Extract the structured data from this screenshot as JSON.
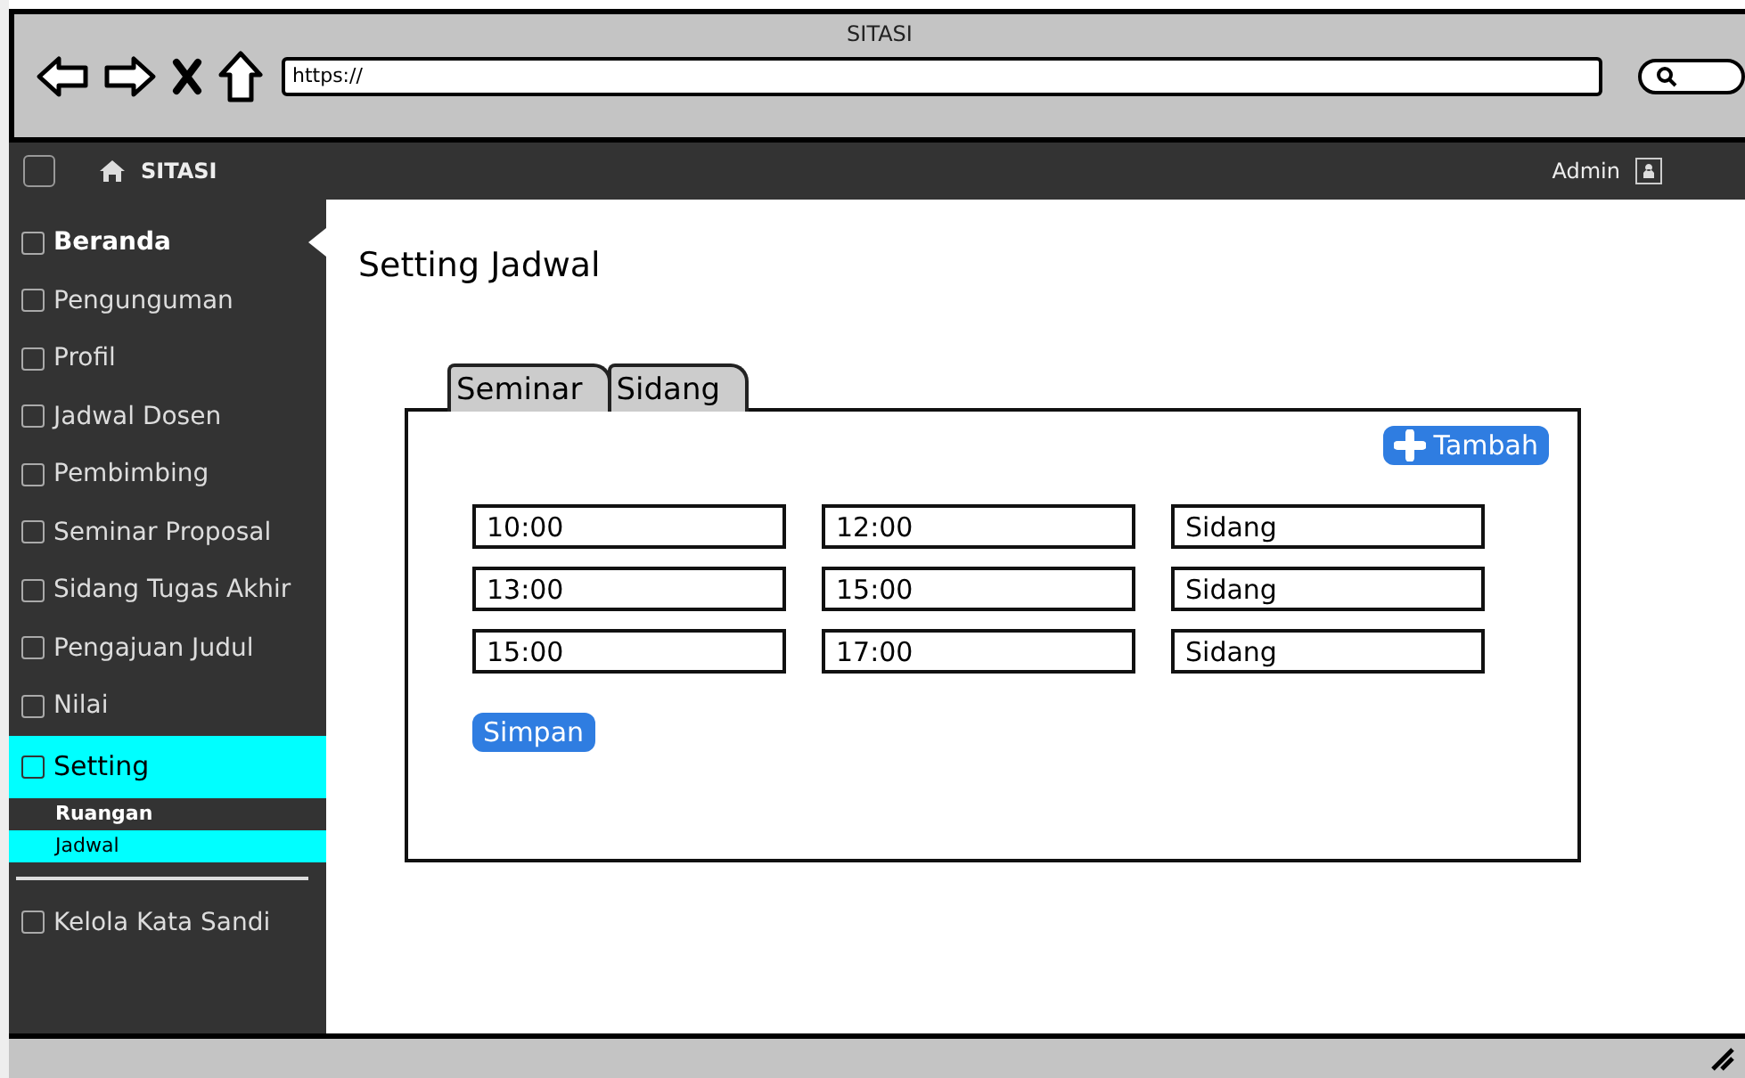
{
  "window": {
    "title": "SITASI"
  },
  "browser": {
    "url": "https://"
  },
  "navbar": {
    "brand": "SITASI",
    "user": "Admin"
  },
  "sidebar": {
    "items": [
      {
        "label": "Beranda",
        "selected": false,
        "bold": true
      },
      {
        "label": "Pengunguman",
        "selected": false,
        "bold": false
      },
      {
        "label": "Profil",
        "selected": false,
        "bold": false
      },
      {
        "label": "Jadwal Dosen",
        "selected": false,
        "bold": false
      },
      {
        "label": "Pembimbing",
        "selected": false,
        "bold": false
      },
      {
        "label": "Seminar Proposal",
        "selected": false,
        "bold": false
      },
      {
        "label": "Sidang Tugas Akhir",
        "selected": false,
        "bold": false
      },
      {
        "label": "Pengajuan Judul",
        "selected": false,
        "bold": false
      },
      {
        "label": "Nilai",
        "selected": false,
        "bold": false
      },
      {
        "label": "Setting",
        "selected": true,
        "bold": false,
        "children": [
          {
            "label": "Ruangan",
            "selected": false
          },
          {
            "label": "Jadwal",
            "selected": true
          }
        ]
      },
      {
        "label": "Kelola Kata Sandi",
        "selected": false,
        "bold": false
      }
    ]
  },
  "page": {
    "title": "Setting Jadwal",
    "tabs": [
      {
        "label": "Seminar"
      },
      {
        "label": "Sidang"
      }
    ],
    "add_button": "Tambah",
    "rows": [
      {
        "start": "10:00",
        "end": "12:00",
        "type": "Sidang"
      },
      {
        "start": "13:00",
        "end": "15:00",
        "type": "Sidang"
      },
      {
        "start": "15:00",
        "end": "17:00",
        "type": "Sidang"
      }
    ],
    "save_button": "Simpan"
  }
}
